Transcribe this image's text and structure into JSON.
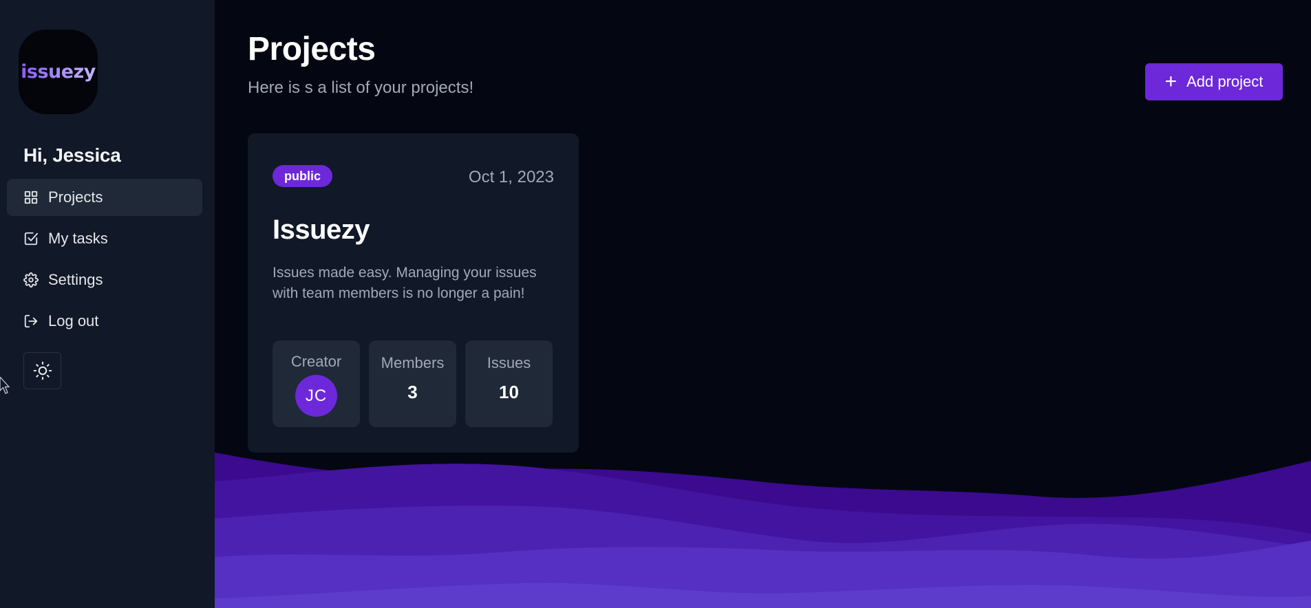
{
  "sidebar": {
    "logo_text": "issuezy",
    "greeting": "Hi, Jessica",
    "items": [
      {
        "label": "Projects",
        "icon": "grid-icon",
        "active": true
      },
      {
        "label": "My tasks",
        "icon": "checkbox-icon",
        "active": false
      },
      {
        "label": "Settings",
        "icon": "gear-icon",
        "active": false
      },
      {
        "label": "Log out",
        "icon": "logout-icon",
        "active": false
      }
    ],
    "theme_toggle_icon": "sun-icon"
  },
  "header": {
    "title": "Projects",
    "subtitle": "Here is s a list of your projects!",
    "add_button_label": "Add project"
  },
  "projects": [
    {
      "visibility": "public",
      "date": "Oct 1, 2023",
      "name": "Issuezy",
      "description": "Issues made easy. Managing your issues with team members is no longer a pain!",
      "stats": {
        "creator_label": "Creator",
        "creator_initials": "JC",
        "members_label": "Members",
        "members_value": "3",
        "issues_label": "Issues",
        "issues_value": "10"
      }
    }
  ],
  "colors": {
    "background": "#040711",
    "sidebar": "#111827",
    "card": "#111827",
    "stat_box": "#1f2937",
    "accent": "#6d28d9",
    "muted_text": "#a3a9b6"
  }
}
